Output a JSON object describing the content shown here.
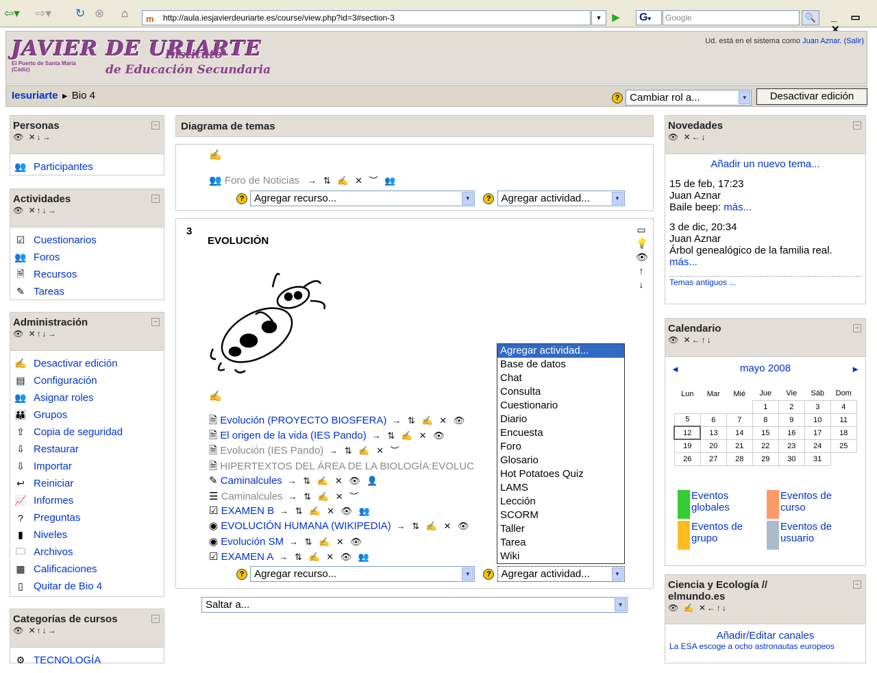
{
  "browser": {
    "url": "http://aula.iesjavierdeuriarte.es/course/view.php?id=3#section-3",
    "search_placeholder": "Google",
    "g_label": "G"
  },
  "header": {
    "logo_main": "JAVIER DE URIARTE",
    "logo_sub1": "Instituto",
    "logo_sub2": "de Educación Secundaria",
    "logo_place": "El Puerto de Santa María (Cádiz)",
    "login_prefix": "Ud. está en el sistema como",
    "login_user": "Juan Aznar.",
    "login_exit": "(Salir)"
  },
  "nav": {
    "home": "Iesuriarte",
    "sep": "►",
    "course": "Bio 4",
    "role_select": "Cambiar rol a...",
    "deactivate": "Desactivar edición"
  },
  "left": {
    "personas": {
      "title": "Personas",
      "controls": "👁 ✕↓→",
      "items": [
        {
          "label": "Participantes",
          "icon": "people-icon",
          "glyph": "👥"
        }
      ]
    },
    "actividades": {
      "title": "Actividades",
      "controls": "👁 ✕↑↓→",
      "items": [
        {
          "label": "Cuestionarios",
          "icon": "quiz-icon",
          "glyph": "☑"
        },
        {
          "label": "Foros",
          "icon": "forum-icon",
          "glyph": "👥"
        },
        {
          "label": "Recursos",
          "icon": "resource-icon",
          "glyph": "🗎"
        },
        {
          "label": "Tareas",
          "icon": "assignment-icon",
          "glyph": "✎"
        }
      ]
    },
    "admin": {
      "title": "Administración",
      "controls": "👁 ✕↑↓→",
      "items": [
        {
          "label": "Desactivar edición",
          "icon": "edit-icon",
          "glyph": "✍"
        },
        {
          "label": "Configuración",
          "icon": "settings-icon",
          "glyph": "▤"
        },
        {
          "label": "Asignar roles",
          "icon": "roles-icon",
          "glyph": "👥"
        },
        {
          "label": "Grupos",
          "icon": "groups-icon",
          "glyph": "👪"
        },
        {
          "label": "Copia de seguridad",
          "icon": "backup-icon",
          "glyph": "⇪"
        },
        {
          "label": "Restaurar",
          "icon": "restore-icon",
          "glyph": "⇩"
        },
        {
          "label": "Importar",
          "icon": "import-icon",
          "glyph": "⇩"
        },
        {
          "label": "Reiniciar",
          "icon": "reset-icon",
          "glyph": "↩"
        },
        {
          "label": "Informes",
          "icon": "reports-icon",
          "glyph": "📈"
        },
        {
          "label": "Preguntas",
          "icon": "questions-icon",
          "glyph": "?"
        },
        {
          "label": "Niveles",
          "icon": "levels-icon",
          "glyph": "▮"
        },
        {
          "label": "Archivos",
          "icon": "folder-icon",
          "glyph": "🗀"
        },
        {
          "label": "Calificaciones",
          "icon": "grades-icon",
          "glyph": "▦"
        },
        {
          "label": "Quitar de Bio 4",
          "icon": "unenrol-icon",
          "glyph": "▯"
        }
      ]
    },
    "categorias": {
      "title": "Categorías de cursos",
      "controls": "👁 ✕↑↓→",
      "items": [
        {
          "label": "TECNOLOGÍA",
          "icon": "category-icon",
          "glyph": "⚙"
        }
      ]
    }
  },
  "center": {
    "title": "Diagrama de temas",
    "sec0": {
      "forum": "Foro de Noticias",
      "forum_acts": "→ ⇅ ✍ ✕ ︶ 👥"
    },
    "add_resource": "Agregar recurso...",
    "add_activity": "Agregar actividad...",
    "sec3": {
      "number": "3",
      "title": "EVOLUCIÓN",
      "items": [
        {
          "label": "Evolución (PROYECTO BIOSFERA)",
          "acts": "→ ⇅ ✍ ✕ 👁",
          "dim": false,
          "glyph": "🗎",
          "icon": "resource-icon"
        },
        {
          "label": "El origen de la vida (IES Pando)",
          "acts": "→ ⇅ ✍ ✕ 👁",
          "dim": false,
          "glyph": "🗎",
          "icon": "resource-icon"
        },
        {
          "label": "Evolución (IES Pando)",
          "acts": "→ ⇅ ✍ ✕ ︶",
          "dim": true,
          "glyph": "🗎",
          "icon": "resource-icon"
        },
        {
          "label": "HIPERTEXTOS DEL ÁREA DE LA BIOLOGÍA:EVOLUC",
          "acts": "",
          "dim": true,
          "glyph": "🗎",
          "icon": "resource-icon"
        },
        {
          "label": "Caminalcules",
          "acts": "→ ⇅ ✍ ✕ 👁 👤",
          "dim": false,
          "glyph": "✎",
          "icon": "assignment-icon"
        },
        {
          "label": "Caminalcules",
          "acts": "→ ⇅ ✍ ✕ ︶",
          "dim": true,
          "glyph": "☰",
          "icon": "label-icon"
        },
        {
          "label": "EXAMEN B",
          "acts": "→ ⇅ ✍ ✕ 👁 👥",
          "dim": false,
          "glyph": "☑",
          "icon": "quiz-icon"
        },
        {
          "label": "EVOLUCIÓN HUMANA (WIKIPEDIA)",
          "acts": "→ ⇅ ✍ ✕ 👁",
          "dim": false,
          "glyph": "◉",
          "icon": "link-icon"
        },
        {
          "label": "Evolución SM",
          "acts": "→ ⇅ ✍ ✕ 👁",
          "dim": false,
          "glyph": "◉",
          "icon": "link-icon"
        },
        {
          "label": "EXAMEN A",
          "acts": "→ ⇅ ✍ ✕ 👁 👥",
          "dim": false,
          "glyph": "☑",
          "icon": "quiz-icon"
        }
      ]
    },
    "dropdown_options": [
      "Agregar actividad...",
      "Base de datos",
      "Chat",
      "Consulta",
      "Cuestionario",
      "Diario",
      "Encuesta",
      "Foro",
      "Glosario",
      "Hot Potatoes Quiz",
      "LAMS",
      "Lección",
      "SCORM",
      "Taller",
      "Tarea",
      "Wiki"
    ],
    "jump": "Saltar a..."
  },
  "right": {
    "novedades": {
      "title": "Novedades",
      "controls": "👁 ✕←↓",
      "add": "Añadir un nuevo tema...",
      "posts": [
        {
          "date": "15 de feb, 17:23",
          "author": "Juan Aznar",
          "text": "Baile beep:",
          "more": "más..."
        },
        {
          "date": "3 de dic, 20:34",
          "author": "Juan Aznar",
          "text": "Árbol genealógico de la familia real.",
          "more": "más..."
        }
      ],
      "older": "Temas antiguos ..."
    },
    "calendario": {
      "title": "Calendario",
      "controls": "👁 ✕←↑↓",
      "month": "mayo 2008",
      "days": [
        "Lun",
        "Mar",
        "Mié",
        "Jue",
        "Vie",
        "Sáb",
        "Dom"
      ],
      "weeks": [
        [
          "",
          "",
          "",
          "1",
          "2",
          "3",
          "4"
        ],
        [
          "5",
          "6",
          "7",
          "8",
          "9",
          "10",
          "11"
        ],
        [
          "12",
          "13",
          "14",
          "15",
          "16",
          "17",
          "18"
        ],
        [
          "19",
          "20",
          "21",
          "22",
          "23",
          "24",
          "25"
        ],
        [
          "26",
          "27",
          "28",
          "29",
          "30",
          "31",
          ""
        ]
      ],
      "today": "12",
      "legend": [
        {
          "label1": "Eventos",
          "label2": "globales",
          "color": "#33cc33"
        },
        {
          "label1": "Eventos de",
          "label2": "curso",
          "color": "#ff9966"
        },
        {
          "label1": "Eventos de",
          "label2": "grupo",
          "color": "#ffbb22"
        },
        {
          "label1": "Eventos de",
          "label2": "usuario",
          "color": "#aabbcc"
        }
      ]
    },
    "ciencia": {
      "title1": "Ciencia y Ecología //",
      "title2": "elmundo.es",
      "controls": "👁 ✍ ✕←↑↓",
      "edit": "Añadir/Editar canales",
      "news": "La ESA escoge a ocho astronautas europeos"
    }
  }
}
